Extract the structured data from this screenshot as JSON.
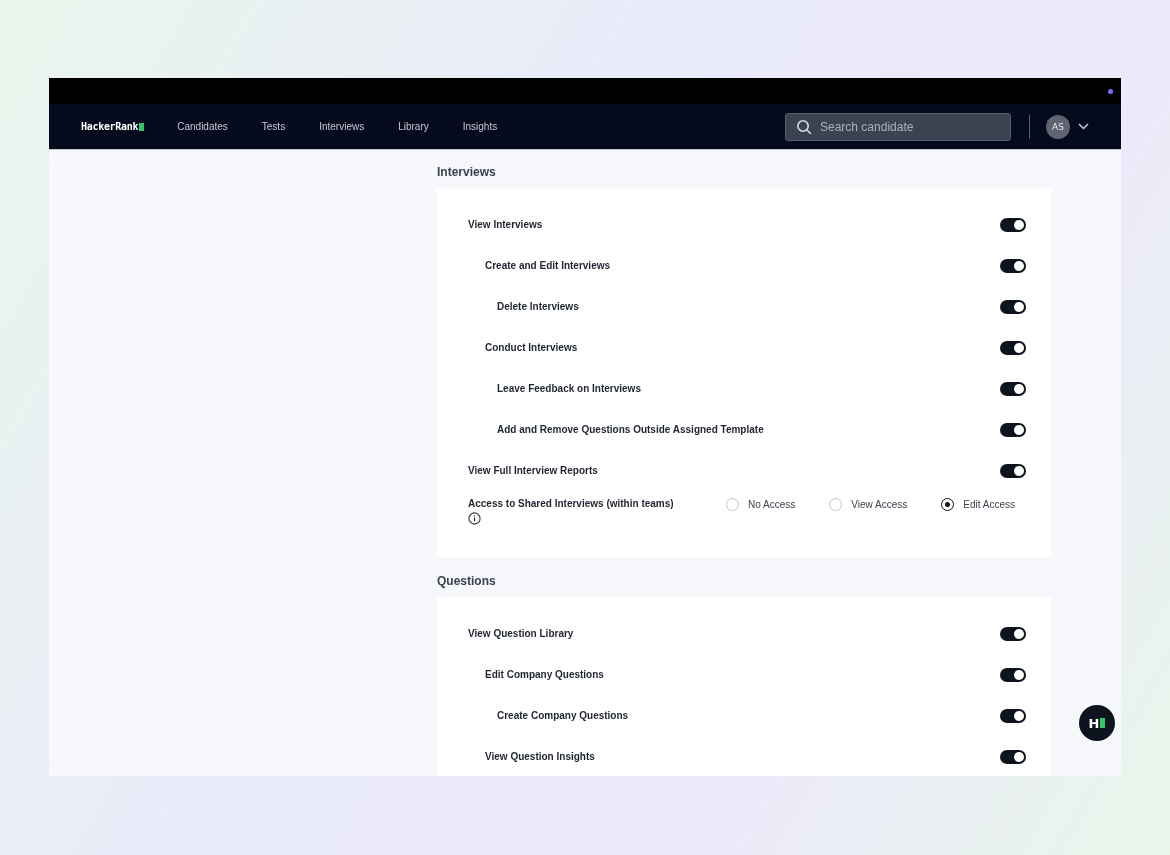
{
  "nav": {
    "logo": "HackerRank",
    "links": [
      {
        "label": "Candidates",
        "selected": false
      },
      {
        "label": "Tests",
        "selected": false
      },
      {
        "label": "Interviews",
        "selected": false
      },
      {
        "label": "Library",
        "selected": false
      },
      {
        "label": "Insights",
        "selected": false
      }
    ],
    "search": {
      "placeholder": "Search candidate"
    },
    "avatar": "AS"
  },
  "sections": [
    {
      "title": "Interviews",
      "items": [
        {
          "kind": "toggle",
          "label": "View Interviews",
          "on": true,
          "children": [
            {
              "kind": "toggle",
              "label": "Create and Edit Interviews",
              "on": true,
              "children": [
                {
                  "kind": "toggle",
                  "label": "Delete Interviews",
                  "on": true
                }
              ]
            },
            {
              "kind": "toggle",
              "label": "Conduct Interviews",
              "on": true,
              "children": [
                {
                  "kind": "toggle",
                  "label": "Leave Feedback on Interviews",
                  "on": true
                },
                {
                  "kind": "toggle",
                  "label": "Add and Remove Questions Outside Assigned Template",
                  "on": true
                }
              ]
            }
          ]
        },
        {
          "kind": "toggle",
          "label": "View Full Interview Reports",
          "on": true
        },
        {
          "kind": "radio",
          "label": "Access to Shared Interviews (within teams)",
          "info": true,
          "options": [
            {
              "label": "No Access",
              "selected": false
            },
            {
              "label": "View Access",
              "selected": false
            },
            {
              "label": "Edit Access",
              "selected": true
            }
          ]
        }
      ]
    },
    {
      "title": "Questions",
      "items": [
        {
          "kind": "toggle",
          "label": "View Question Library",
          "on": true,
          "children": [
            {
              "kind": "toggle",
              "label": "Edit Company Questions",
              "on": true,
              "children": [
                {
                  "kind": "toggle",
                  "label": "Create Company Questions",
                  "on": true
                }
              ]
            },
            {
              "kind": "toggle",
              "label": "View Question Insights",
              "on": true
            }
          ]
        }
      ]
    }
  ],
  "help_button": {
    "label": "H"
  }
}
